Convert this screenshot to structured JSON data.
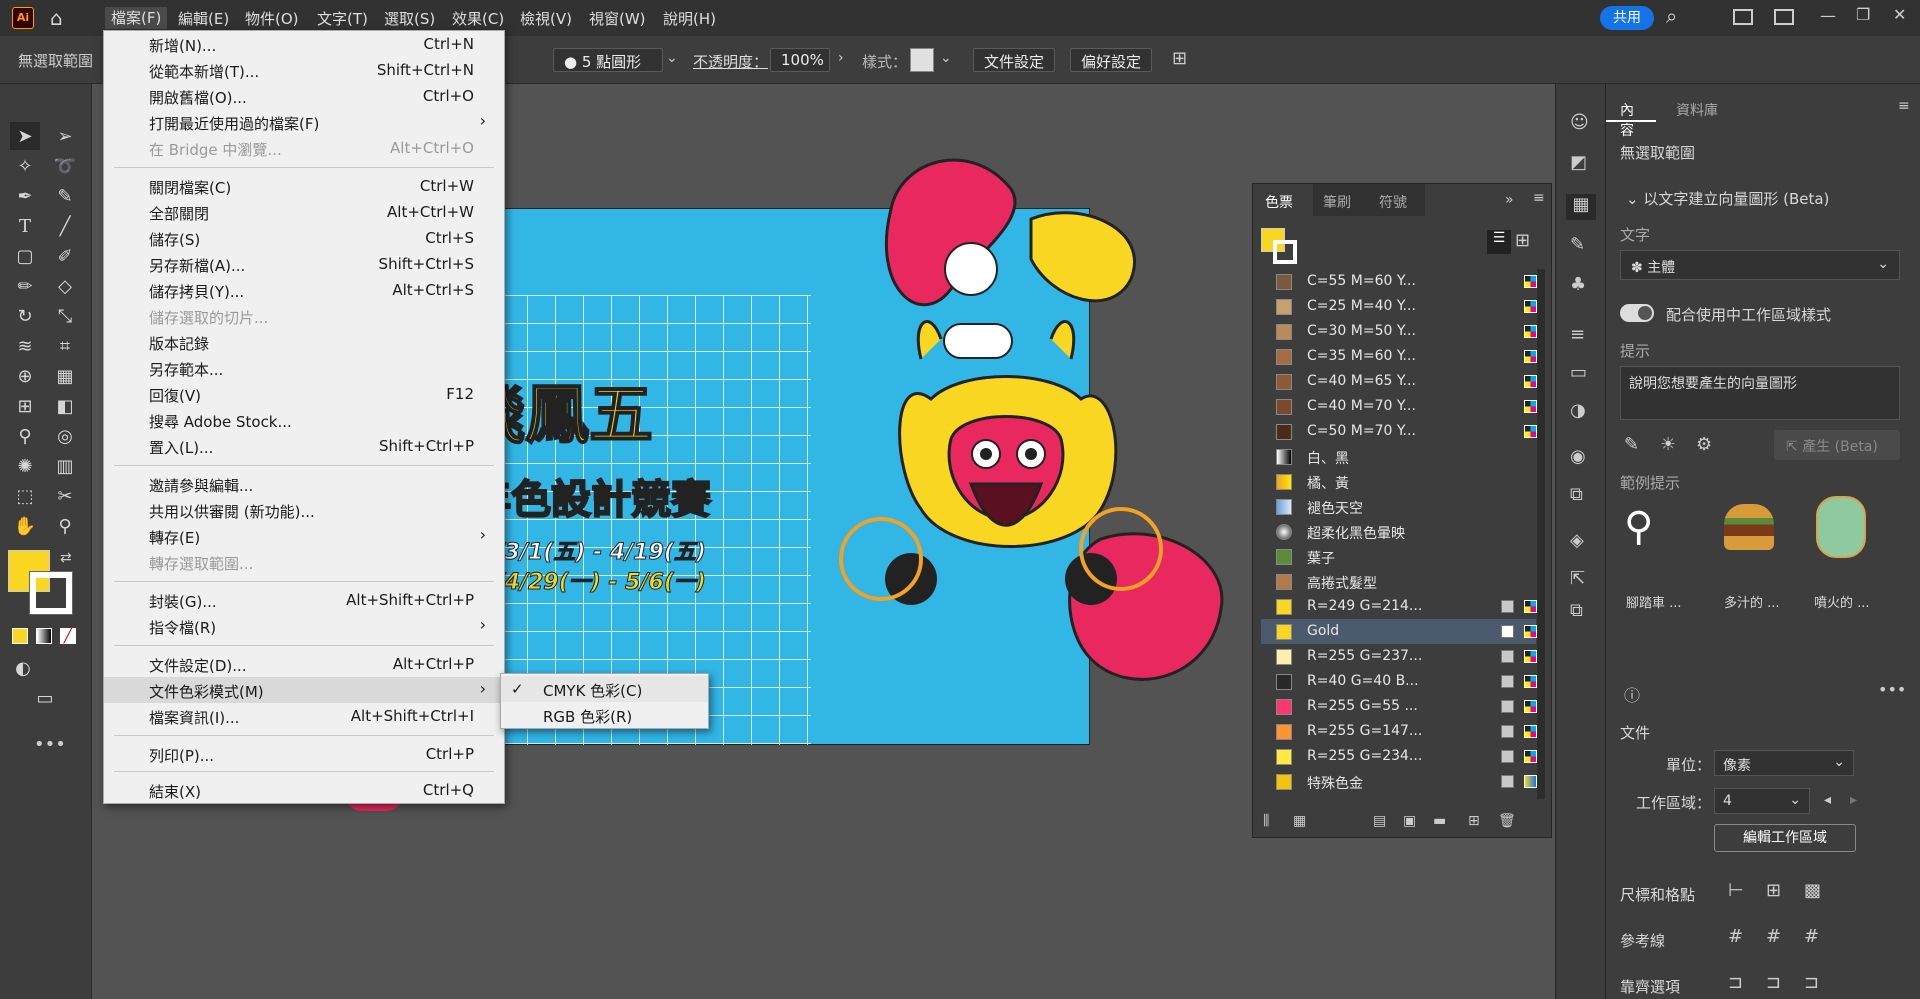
{
  "app": {
    "logo": "Ai"
  },
  "menubar": {
    "items": [
      "檔案(F)",
      "編輯(E)",
      "物件(O)",
      "文字(T)",
      "選取(S)",
      "效果(C)",
      "檢視(V)",
      "視窗(W)",
      "說明(H)"
    ],
    "share_label": "共用"
  },
  "controlbar": {
    "selection_status": "無選取範圍",
    "brush_label": "5 點圓形",
    "opacity_label": "不透明度：",
    "opacity_value": "100%",
    "style_label": "樣式：",
    "doc_setup": "文件設定",
    "prefs": "偏好設定"
  },
  "filemenu": {
    "items": [
      {
        "label": "新增(N)...",
        "shortcut": "Ctrl+N"
      },
      {
        "label": "從範本新增(T)...",
        "shortcut": "Shift+Ctrl+N"
      },
      {
        "label": "開啟舊檔(O)...",
        "shortcut": "Ctrl+O"
      },
      {
        "label": "打開最近使用過的檔案(F)",
        "shortcut": ""
      },
      {
        "label": "在 Bridge 中瀏覽...",
        "shortcut": "Alt+Ctrl+O"
      },
      {
        "label": "關閉檔案(C)",
        "shortcut": "Ctrl+W"
      },
      {
        "label": "全部關閉",
        "shortcut": "Alt+Ctrl+W"
      },
      {
        "label": "儲存(S)",
        "shortcut": "Ctrl+S"
      },
      {
        "label": "另存新檔(A)...",
        "shortcut": "Shift+Ctrl+S"
      },
      {
        "label": "儲存拷貝(Y)...",
        "shortcut": "Alt+Ctrl+S"
      },
      {
        "label": "儲存選取的切片...",
        "shortcut": ""
      },
      {
        "label": "版本記錄",
        "shortcut": ""
      },
      {
        "label": "另存範本...",
        "shortcut": ""
      },
      {
        "label": "回復(V)",
        "shortcut": "F12"
      },
      {
        "label": "搜尋 Adobe Stock...",
        "shortcut": ""
      },
      {
        "label": "置入(L)...",
        "shortcut": "Shift+Ctrl+P"
      },
      {
        "label": "邀請參與編輯...",
        "shortcut": ""
      },
      {
        "label": "共用以供審閱 (新功能)...",
        "shortcut": ""
      },
      {
        "label": "轉存(E)",
        "shortcut": ""
      },
      {
        "label": "轉存選取範圍...",
        "shortcut": ""
      },
      {
        "label": "封裝(G)...",
        "shortcut": "Alt+Shift+Ctrl+P"
      },
      {
        "label": "指令檔(R)",
        "shortcut": ""
      },
      {
        "label": "文件設定(D)...",
        "shortcut": "Alt+Ctrl+P"
      },
      {
        "label": "文件色彩模式(M)",
        "shortcut": ""
      },
      {
        "label": "檔案資訊(I)...",
        "shortcut": "Alt+Shift+Ctrl+I"
      },
      {
        "label": "列印(P)...",
        "shortcut": "Ctrl+P"
      },
      {
        "label": "結束(X)",
        "shortcut": "Ctrl+Q"
      }
    ]
  },
  "submenu": {
    "cmyk": "CMYK 色彩(C)",
    "rgb": "RGB 色彩(R)"
  },
  "artwork": {
    "title1": "飛鳳五",
    "title2": "年色設計競賽",
    "date1": "24/3/1(五) - 4/19(五)",
    "date2": "24/4/29(一) - 5/6(一)"
  },
  "swatch_panel": {
    "tabs": [
      "色票",
      "筆刷",
      "符號"
    ],
    "rows": [
      {
        "name": "C=55 M=60 Y...",
        "color": "#7a5a3c",
        "spot": false
      },
      {
        "name": "C=25 M=40 Y...",
        "color": "#c8a070",
        "spot": false
      },
      {
        "name": "C=30 M=50 Y...",
        "color": "#b98a5a",
        "spot": false
      },
      {
        "name": "C=35 M=60 Y...",
        "color": "#a56e42",
        "spot": false
      },
      {
        "name": "C=40 M=65 Y...",
        "color": "#8e5a34",
        "spot": false
      },
      {
        "name": "C=40 M=70 Y...",
        "color": "#7a4a2a",
        "spot": false
      },
      {
        "name": "C=50 M=70 Y...",
        "color": "#4a2c18",
        "spot": false
      },
      {
        "name": "白、黑",
        "color": "#999999",
        "spot": false
      },
      {
        "name": "橘、黃",
        "color": "#f4a224",
        "spot": false
      },
      {
        "name": "褪色天空",
        "color": "#6a9fd8",
        "spot": false
      },
      {
        "name": "超柔化黑色暈映",
        "color": "#dddddd",
        "spot": false
      },
      {
        "name": "葉子",
        "color": "#5a8a3a",
        "spot": false
      },
      {
        "name": "高捲式髮型",
        "color": "#b07a4a",
        "spot": false
      },
      {
        "name": "R=249 G=214...",
        "color": "#f9d621",
        "spot": true
      },
      {
        "name": "Gold",
        "color": "#f9d621",
        "spot": true
      },
      {
        "name": "R=255 G=237...",
        "color": "#ffedb0",
        "spot": true
      },
      {
        "name": "R=40 G=40 B...",
        "color": "#282828",
        "spot": true
      },
      {
        "name": "R=255 G=55 ...",
        "color": "#ff3770",
        "spot": true
      },
      {
        "name": "R=255 G=147...",
        "color": "#ff9330",
        "spot": true
      },
      {
        "name": "R=255 G=234...",
        "color": "#ffea40",
        "spot": true
      },
      {
        "name": "特殊色金",
        "color": "#f2c410",
        "spot": true
      }
    ]
  },
  "right_panel": {
    "tabs": [
      "內容",
      "資料庫"
    ],
    "no_selection": "無選取範圍",
    "text_to_vector": "以文字建立向量圖形 (Beta)",
    "text_label": "文字",
    "subject": "主體",
    "match_style": "配合使用中工作區域樣式",
    "hint_label": "提示",
    "hint_placeholder": "說明您想要產生的向量圖形",
    "generate": "產生 (Beta)",
    "examples_label": "範例提示",
    "examples": [
      "腳踏車 ...",
      "多汁的 ...",
      "噴火的 ..."
    ],
    "doc_label": "文件",
    "units_label": "單位：",
    "units_value": "像素",
    "artboard_label": "工作區域：",
    "artboard_value": "4",
    "edit_artboards": "編輯工作區域",
    "rulers": "尺標和格點",
    "guides": "參考線",
    "snap": "靠齊選項"
  }
}
